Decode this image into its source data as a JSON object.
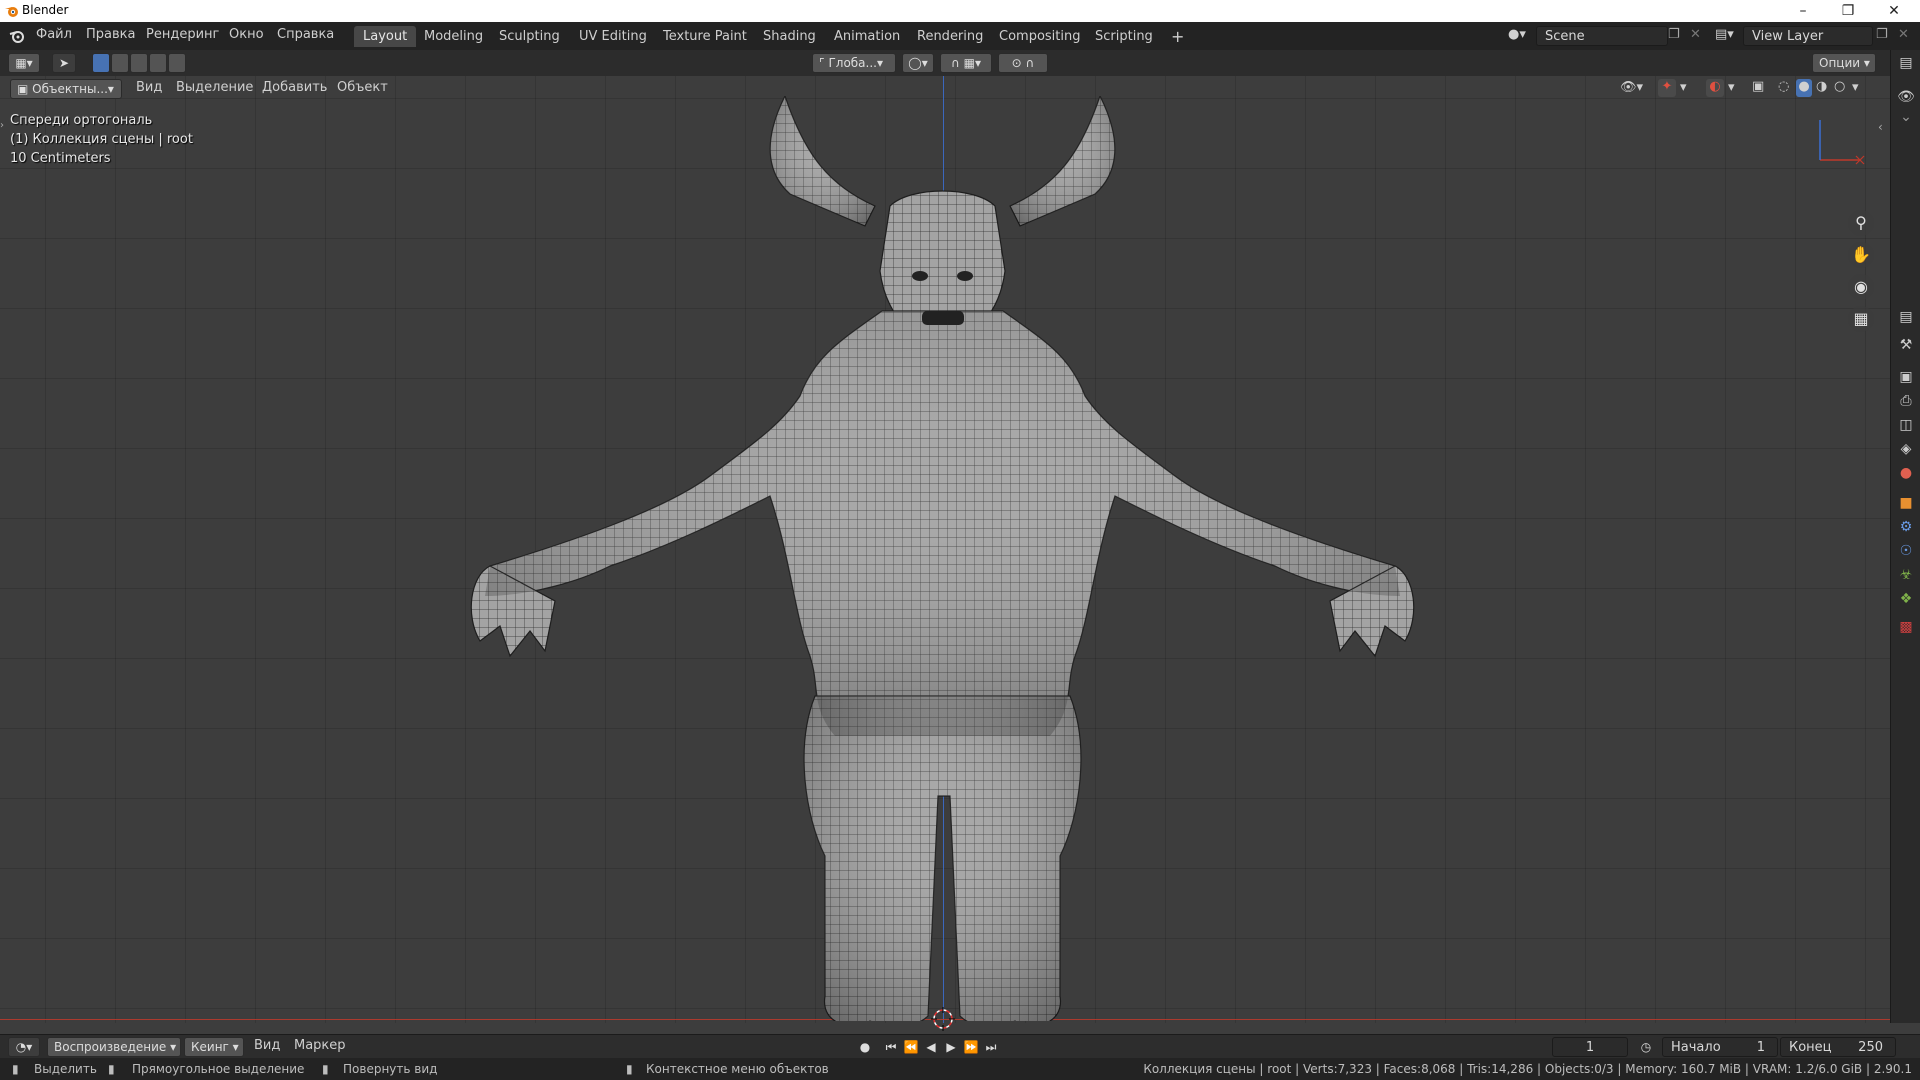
{
  "window": {
    "title": "Blender"
  },
  "menu": [
    "Файл",
    "Правка",
    "Рендеринг",
    "Окно",
    "Справка"
  ],
  "workspaces": [
    "Layout",
    "Modeling",
    "Sculpting",
    "UV Editing",
    "Texture Paint",
    "Shading",
    "Animation",
    "Rendering",
    "Compositing",
    "Scripting"
  ],
  "active_workspace": "Layout",
  "scene": {
    "name": "Scene",
    "view_layer": "View Layer"
  },
  "toolheader": {
    "orientation": "Глоба...",
    "options": "Опции"
  },
  "viewport_header": {
    "mode": "Объектны...",
    "menus": [
      "Вид",
      "Выделение",
      "Добавить",
      "Объект"
    ]
  },
  "overlay": {
    "view_name": "Спереди ортогональ",
    "collection": "(1) Коллекция сцены | root",
    "scale": "10 Centimeters"
  },
  "timeline": {
    "playback": "Воспроизведение",
    "keying": "Кеинг",
    "view": "Вид",
    "marker": "Маркер",
    "current_frame": "1",
    "start_label": "Начало",
    "start": "1",
    "end_label": "Конец",
    "end": "250"
  },
  "statusbar": {
    "select": "Выделить",
    "box_select": "Прямоугольное выделение",
    "rotate_view": "Повернуть вид",
    "context_menu": "Контекстное меню объектов",
    "stats": "Коллекция сцены | root | Verts:7,323 | Faces:8,068 | Tris:14,286 | Objects:0/3 | Memory: 160.7 MiB | VRAM: 1.2/6.0 GiB | 2.90.1"
  },
  "colors": {
    "accent": "#4772b3",
    "x_axis": "#c0392b",
    "y_axis": "#7fb24a",
    "z_axis": "#3b6fd4",
    "mesh": "#9a9a9a"
  }
}
